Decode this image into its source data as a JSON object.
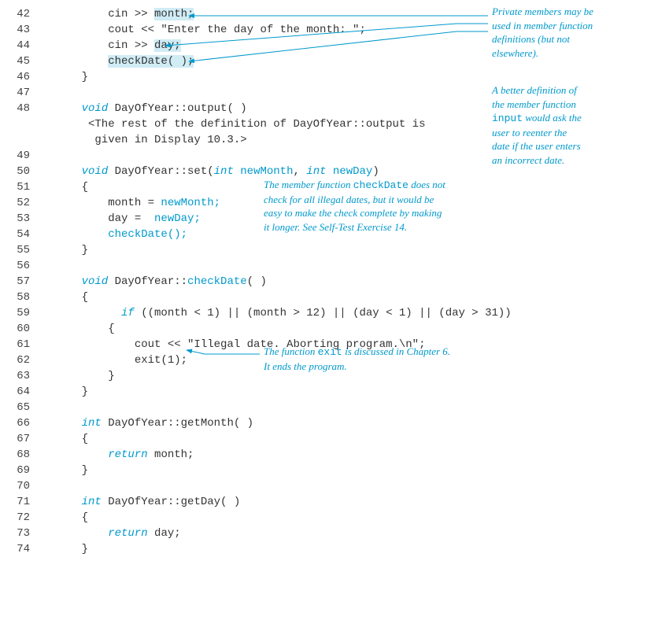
{
  "lines": [
    {
      "num": "42",
      "segs": [
        {
          "t": "        cin >> "
        },
        {
          "t": "month;",
          "cls": "hl"
        }
      ]
    },
    {
      "num": "43",
      "segs": [
        {
          "t": "        cout << \"Enter the day of the month: \";"
        }
      ]
    },
    {
      "num": "44",
      "segs": [
        {
          "t": "        cin >> "
        },
        {
          "t": "day;",
          "cls": "hl"
        }
      ]
    },
    {
      "num": "45",
      "segs": [
        {
          "t": "        "
        },
        {
          "t": "checkDate( );",
          "cls": "hl"
        }
      ]
    },
    {
      "num": "46",
      "segs": [
        {
          "t": "    }"
        }
      ]
    },
    {
      "num": "47",
      "segs": [
        {
          "t": ""
        }
      ]
    },
    {
      "num": "48",
      "segs": [
        {
          "t": "    "
        },
        {
          "t": "void",
          "cls": "kw"
        },
        {
          "t": " DayOfYear::output( )"
        }
      ]
    },
    {
      "num": "",
      "segs": [
        {
          "t": "     <The rest of the definition of DayOfYear::output is"
        }
      ]
    },
    {
      "num": "",
      "segs": [
        {
          "t": "      given in Display 10.3.>"
        }
      ]
    },
    {
      "num": "49",
      "segs": [
        {
          "t": ""
        }
      ]
    },
    {
      "num": "50",
      "segs": [
        {
          "t": "    "
        },
        {
          "t": "void",
          "cls": "kw"
        },
        {
          "t": " DayOfYear::set("
        },
        {
          "t": "int",
          "cls": "kw"
        },
        {
          "t": " "
        },
        {
          "t": "newMonth",
          "cls": "blue"
        },
        {
          "t": ", "
        },
        {
          "t": "int",
          "cls": "kw"
        },
        {
          "t": " "
        },
        {
          "t": "newDay",
          "cls": "blue"
        },
        {
          "t": ")"
        }
      ]
    },
    {
      "num": "51",
      "segs": [
        {
          "t": "    {"
        }
      ]
    },
    {
      "num": "52",
      "segs": [
        {
          "t": "        month = "
        },
        {
          "t": "newMonth;",
          "cls": "blue"
        }
      ]
    },
    {
      "num": "53",
      "segs": [
        {
          "t": "        day =  "
        },
        {
          "t": "newDay;",
          "cls": "blue"
        }
      ]
    },
    {
      "num": "54",
      "segs": [
        {
          "t": "        "
        },
        {
          "t": "checkDate();",
          "cls": "blue"
        }
      ]
    },
    {
      "num": "55",
      "segs": [
        {
          "t": "    }"
        }
      ]
    },
    {
      "num": "56",
      "segs": [
        {
          "t": ""
        }
      ]
    },
    {
      "num": "57",
      "segs": [
        {
          "t": "    "
        },
        {
          "t": "void",
          "cls": "kw"
        },
        {
          "t": " DayOfYear::"
        },
        {
          "t": "checkDate",
          "cls": "blue"
        },
        {
          "t": "( )"
        }
      ]
    },
    {
      "num": "58",
      "segs": [
        {
          "t": "    {"
        }
      ]
    },
    {
      "num": "59",
      "segs": [
        {
          "t": "          "
        },
        {
          "t": "if",
          "cls": "kw"
        },
        {
          "t": " ((month < 1) || (month > 12) || (day < 1) || (day > 31))"
        }
      ]
    },
    {
      "num": "60",
      "segs": [
        {
          "t": "        {"
        }
      ]
    },
    {
      "num": "61",
      "segs": [
        {
          "t": "            cout << \"Illegal date. Aborting program.\\n\";"
        }
      ]
    },
    {
      "num": "62",
      "segs": [
        {
          "t": "            exit(1);"
        }
      ]
    },
    {
      "num": "63",
      "segs": [
        {
          "t": "        }"
        }
      ]
    },
    {
      "num": "64",
      "segs": [
        {
          "t": "    }"
        }
      ]
    },
    {
      "num": "65",
      "segs": [
        {
          "t": ""
        }
      ]
    },
    {
      "num": "66",
      "segs": [
        {
          "t": "    "
        },
        {
          "t": "int",
          "cls": "kw"
        },
        {
          "t": " DayOfYear::getMonth( )"
        }
      ]
    },
    {
      "num": "67",
      "segs": [
        {
          "t": "    {"
        }
      ]
    },
    {
      "num": "68",
      "segs": [
        {
          "t": "        "
        },
        {
          "t": "return",
          "cls": "kw"
        },
        {
          "t": " month;"
        }
      ]
    },
    {
      "num": "69",
      "segs": [
        {
          "t": "    }"
        }
      ]
    },
    {
      "num": "70",
      "segs": [
        {
          "t": ""
        }
      ]
    },
    {
      "num": "71",
      "segs": [
        {
          "t": "    "
        },
        {
          "t": "int",
          "cls": "kw"
        },
        {
          "t": " DayOfYear::getDay( )"
        }
      ]
    },
    {
      "num": "72",
      "segs": [
        {
          "t": "    {"
        }
      ]
    },
    {
      "num": "73",
      "segs": [
        {
          "t": "        "
        },
        {
          "t": "return",
          "cls": "kw"
        },
        {
          "t": " day;"
        }
      ]
    },
    {
      "num": "74",
      "segs": [
        {
          "t": "    }"
        }
      ]
    }
  ],
  "annotations": {
    "a1": {
      "l1": "Private members may be",
      "l2": "used in member function",
      "l3": "definitions (but not",
      "l4": "elsewhere)."
    },
    "a2": {
      "l1": "A better definition of",
      "l2": "the member function",
      "l3_pre": "input",
      "l3_post": " would ask the",
      "l4": "user to reenter the",
      "l5": "date if the user enters",
      "l6": "an incorrect date."
    },
    "a3": {
      "l1_pre": "The member function ",
      "l1_code": "checkDate",
      "l1_post": " does not",
      "l2": "check for all illegal dates, but it would be",
      "l3": "easy to make the check complete by making",
      "l4": "it longer. See Self-Test Exercise 14."
    },
    "a4": {
      "l1_pre": "The function ",
      "l1_code": "exit",
      "l1_post": " is discussed in Chapter 6.",
      "l2": "It ends the program."
    }
  }
}
